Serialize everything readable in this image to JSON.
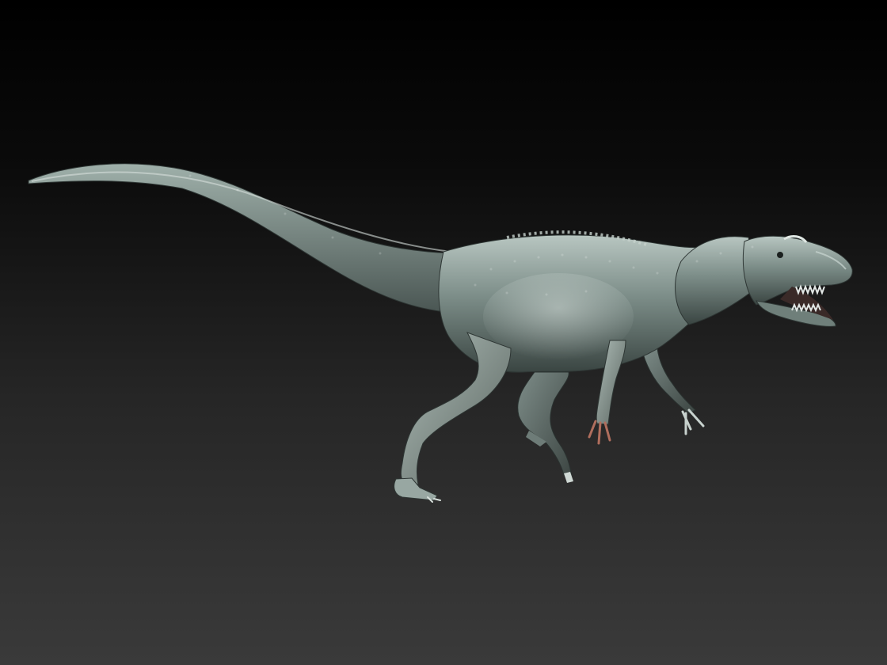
{
  "scene": {
    "subject": "sculpted-theropod-dinosaur-model",
    "background_top_color": "#000000",
    "background_bottom_color": "#3a3a3a",
    "model_base_color": "#7c8d88",
    "model_highlight_color": "#c9d6d1",
    "model_shadow_color": "#2e3634",
    "model_rim_color": "#a0685a"
  }
}
